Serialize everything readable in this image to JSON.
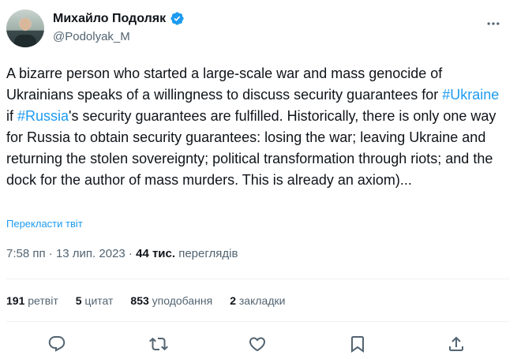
{
  "author": {
    "name": "Михайло Подоляк",
    "handle": "@Podolyak_M"
  },
  "tweet": {
    "part1": "A bizarre person who started a large-scale war and mass genocide of Ukrainians speaks of a willingness to discuss security guarantees for ",
    "hashtag1": "#Ukraine",
    "part2": " if ",
    "hashtag2": "#Russia",
    "part3": "'s security guarantees are fulfilled. Historically, there is only one way for Russia to obtain security guarantees: losing the war; leaving Ukraine and returning the stolen sovereignty; political transformation through riots; and the dock for the author of mass murders. This is already an axiom)..."
  },
  "translate_label": "Перекласти твіт",
  "meta": {
    "time": "7:58 пп",
    "separator1": " · ",
    "date": "13 лип. 2023",
    "separator2": " · ",
    "views_count": "44 тис.",
    "views_label": "переглядів"
  },
  "stats": {
    "retweets_count": "191",
    "retweets_label": "ретвіт",
    "quotes_count": "5",
    "quotes_label": "цитат",
    "likes_count": "853",
    "likes_label": "уподобання",
    "bookmarks_count": "2",
    "bookmarks_label": "закладки"
  },
  "icons": [
    "verified-badge-icon",
    "more-icon",
    "reply-icon",
    "retweet-icon",
    "like-icon",
    "bookmark-icon",
    "share-icon"
  ],
  "colors": {
    "accent": "#1d9bf0",
    "text": "#0f1419",
    "secondary": "#536471",
    "divider": "#eff3f4"
  }
}
